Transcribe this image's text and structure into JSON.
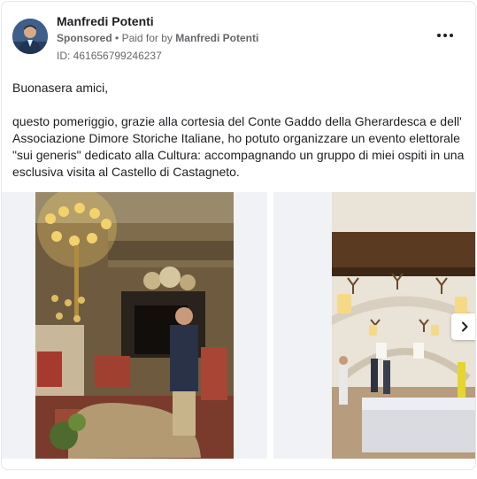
{
  "post": {
    "author": "Manfredi Potenti",
    "sponsored": "Sponsored",
    "paid_for_prefix": "Paid for by",
    "paid_for_name": "Manfredi Potenti",
    "id_text": "ID: 461656799246237",
    "paragraphs": [
      "Buonasera amici,",
      "questo pomeriggio, grazie alla cortesia del Conte Gaddo della Gherardesca e dell' Associazione Dimore Storiche Italiane, ho potuto organizzare un evento elettorale \"sui generis\" dedicato alla Cultura: accompagnando un gruppo di miei ospiti in una esclusiva visita al Castello di Castagneto."
    ]
  },
  "icons": {
    "more": "more-horizontal-icon",
    "next": "chevron-right-icon"
  },
  "colors": {
    "text": "#1c1e21",
    "secondary": "#65676b",
    "border": "#e4e6eb",
    "image_bg": "#f0f2f5"
  }
}
